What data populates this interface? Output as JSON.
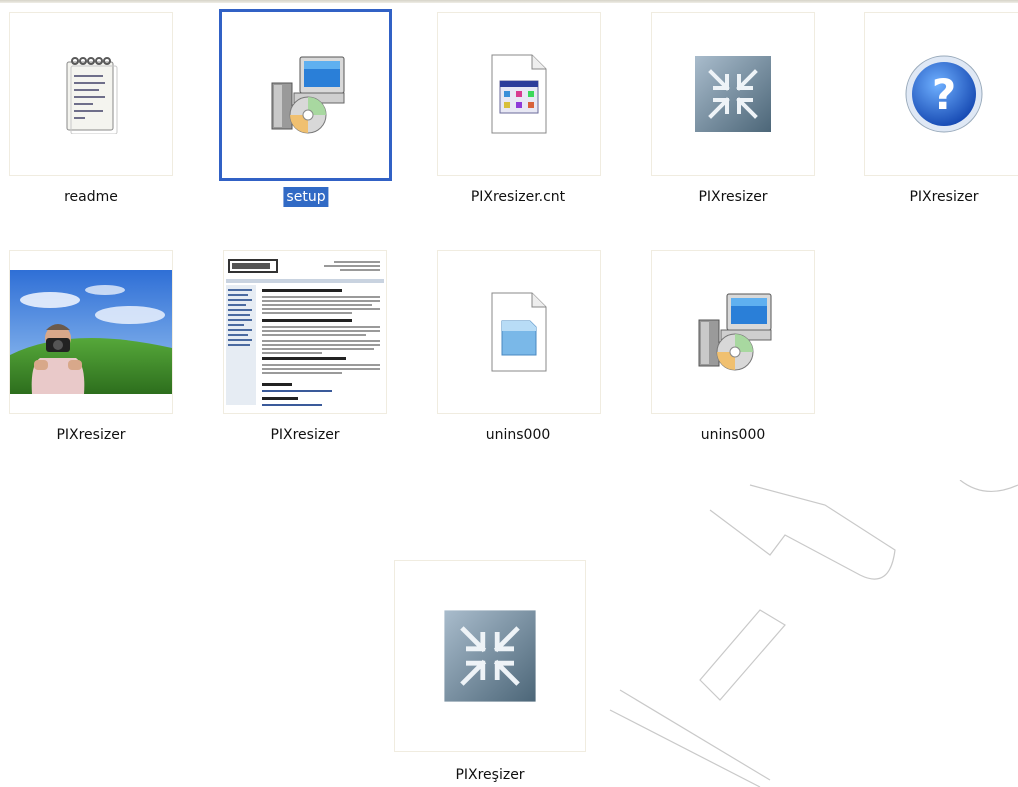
{
  "files": [
    {
      "label": "readme",
      "icon": "notepad-text-file-icon",
      "selected": false
    },
    {
      "label": "setup",
      "icon": "setup-installer-icon",
      "selected": true
    },
    {
      "label": "PIXresizer.cnt",
      "icon": "help-contents-file-icon",
      "selected": false
    },
    {
      "label": "PIXresizer",
      "icon": "pixresizer-arrows-icon",
      "selected": false
    },
    {
      "label": "PIXresizer",
      "icon": "help-question-icon",
      "selected": false
    },
    {
      "label": "PIXresizer",
      "icon": "photographer-thumbnail-image",
      "selected": false
    },
    {
      "label": "PIXresizer",
      "icon": "webpage-thumbnail-image",
      "selected": false
    },
    {
      "label": "unins000",
      "icon": "generic-data-file-icon",
      "selected": false
    },
    {
      "label": "unins000",
      "icon": "uninstaller-icon",
      "selected": false
    },
    {
      "label": "PIXreşizer",
      "icon": "pixresizer-arrows-icon",
      "selected": false
    }
  ],
  "colors": {
    "selection": "#316ac5",
    "selection_border": "#3161c5",
    "thumb_border": "#f0ece0"
  }
}
